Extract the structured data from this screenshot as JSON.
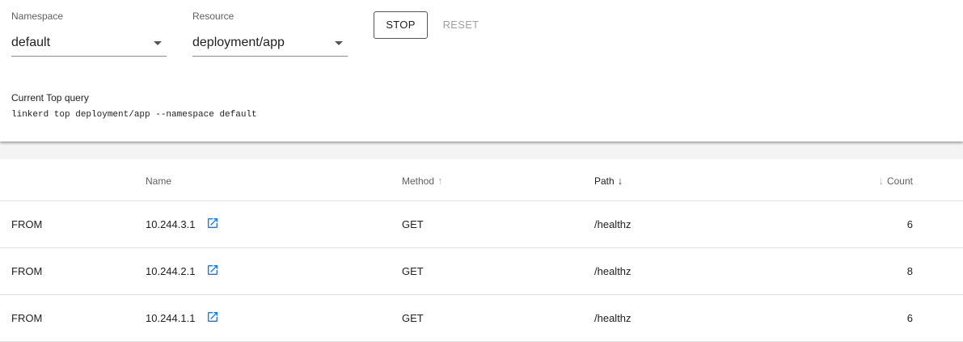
{
  "filters": {
    "namespace": {
      "label": "Namespace",
      "value": "default"
    },
    "resource": {
      "label": "Resource",
      "value": "deployment/app"
    }
  },
  "actions": {
    "stop_label": "STOP",
    "reset_label": "RESET"
  },
  "query": {
    "title": "Current Top query",
    "command": "linkerd top deployment/app --namespace default"
  },
  "table": {
    "columns": {
      "name": "Name",
      "method": "Method",
      "path": "Path",
      "count": "Count"
    },
    "rows": [
      {
        "direction": "FROM",
        "name": "10.244.3.1",
        "method": "GET",
        "path": "/healthz",
        "count": "6"
      },
      {
        "direction": "FROM",
        "name": "10.244.2.1",
        "method": "GET",
        "path": "/healthz",
        "count": "8"
      },
      {
        "direction": "FROM",
        "name": "10.244.1.1",
        "method": "GET",
        "path": "/healthz",
        "count": "6"
      }
    ]
  },
  "icons": {
    "dropdown": "caret-down-icon",
    "external_link": "open-in-new-icon",
    "sort_up": "arrow-up-icon",
    "sort_down": "arrow-down-icon"
  },
  "colors": {
    "link_icon": "#1a73e8",
    "disabled_text": "#a0a0a0"
  }
}
